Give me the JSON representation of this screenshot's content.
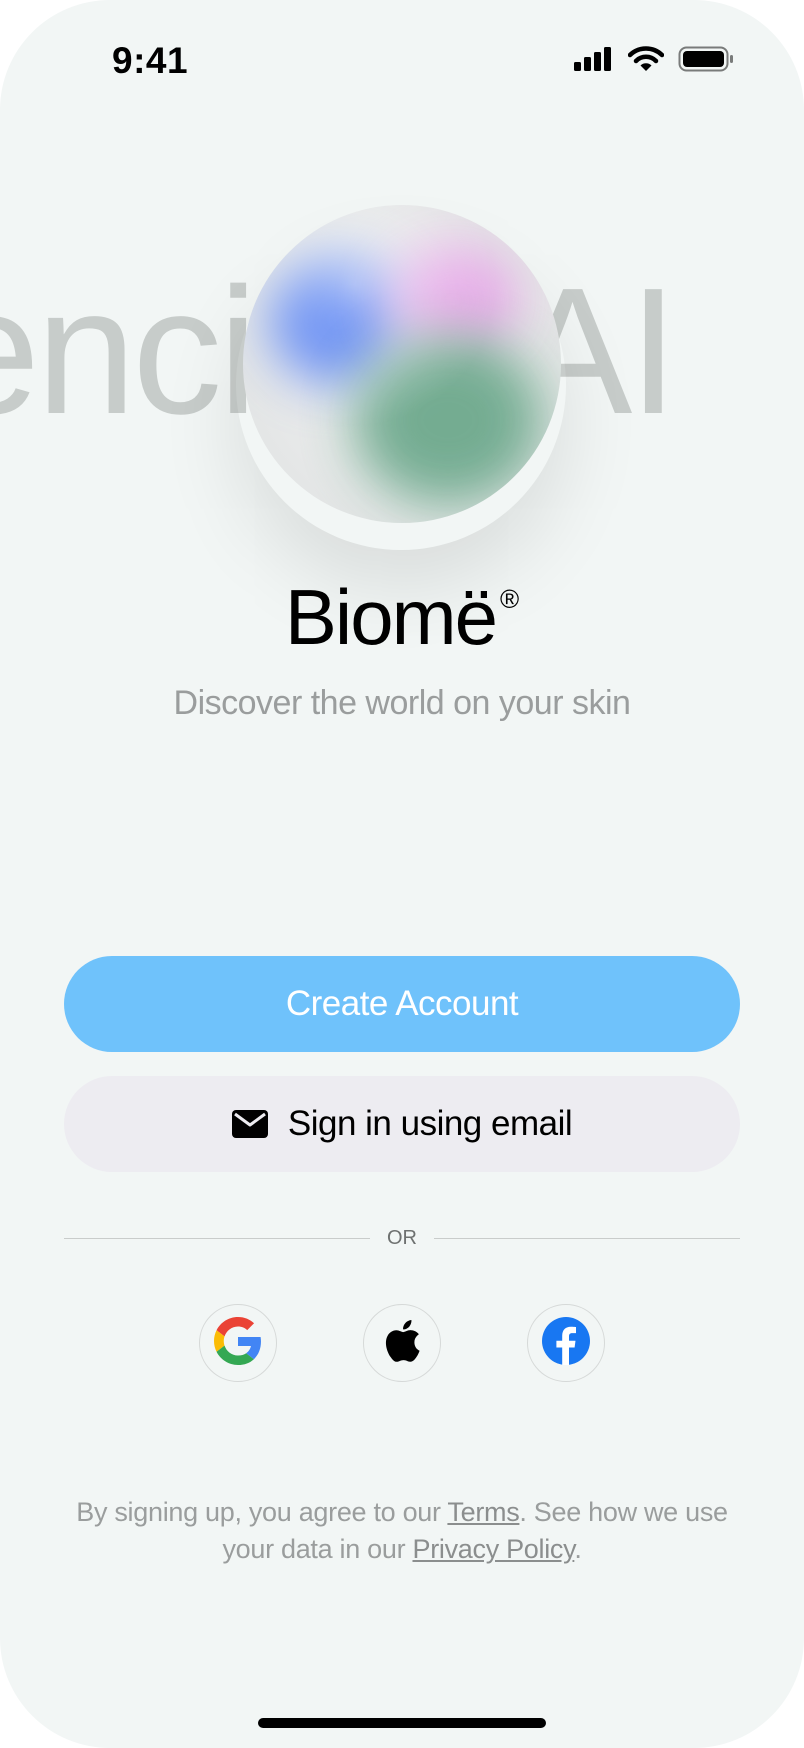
{
  "status_bar": {
    "time": "9:41"
  },
  "background": {
    "marquee_text": "enci → AI"
  },
  "brand": {
    "name": "Biomë",
    "registered_mark": "®",
    "tagline": "Discover the world on your skin"
  },
  "actions": {
    "create_account_label": "Create Account",
    "sign_in_email_label": "Sign in using email",
    "or_label": "OR"
  },
  "social": [
    {
      "name": "google-icon"
    },
    {
      "name": "apple-icon"
    },
    {
      "name": "facebook-icon"
    }
  ],
  "legal": {
    "prefix": "By signing up, you agree to our ",
    "terms_link": "Terms",
    "middle": ". See how we use your data in our ",
    "privacy_link": "Privacy Policy",
    "suffix": "."
  },
  "colors": {
    "background": "#f2f6f5",
    "primary_button": "#6fc2fb",
    "secondary_button": "#edecf1",
    "facebook_blue": "#1877f2"
  }
}
